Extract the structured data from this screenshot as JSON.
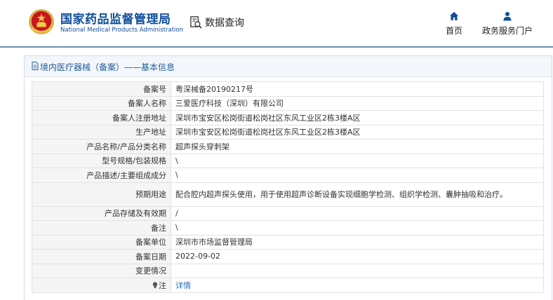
{
  "header": {
    "brand_cn": "国家药品监督管理局",
    "brand_en": "National Medical Products Administration",
    "query_label": "数据查询",
    "nav": {
      "home": "首页",
      "service": "政务服务门户"
    }
  },
  "panel": {
    "title": "境内医疗器械（备案）——基本信息"
  },
  "rows": [
    {
      "label": "备案号",
      "value": "粤深械备20190217号"
    },
    {
      "label": "备案人名称",
      "value": "三爱医疗科技（深圳）有限公司"
    },
    {
      "label": "备案人注册地址",
      "value": "深圳市宝安区松岗街道松岗社区东风工业区2栋3楼A区"
    },
    {
      "label": "生产地址",
      "value": "深圳市宝安区松岗街道松岗社区东风工业区2栋3楼A区"
    },
    {
      "label": "产品名称/产品分类名称",
      "value": "超声探头穿刺架"
    },
    {
      "label": "型号规格/包装规格",
      "value": "\\"
    },
    {
      "label": "产品描述/主要组成成分",
      "value": "\\"
    },
    {
      "label": "预期用途",
      "value": "配合腔内超声探头使用，用于使用超声诊断设备实现细胞学检测、组织学检测、囊肿抽吸和治疗。"
    },
    {
      "label": "产品存储及有效期",
      "value": "/"
    },
    {
      "label": "备注",
      "value": "\\"
    },
    {
      "label": "备案单位",
      "value": "深圳市市场监督管理局"
    },
    {
      "label": "备案日期",
      "value": "2022-09-02"
    },
    {
      "label": "变更情况",
      "value": ""
    },
    {
      "label": "注",
      "value": "详情"
    }
  ],
  "icons": {
    "logo": "national-emblem-icon",
    "query": "search-document-icon",
    "home": "home-icon",
    "service": "user-icon",
    "title": "document-icon",
    "note": "lightbulb-icon"
  },
  "colors": {
    "brand": "#0f4e9c",
    "title": "#1f5c99",
    "link": "#1f6fbf",
    "divider": "#6f8faf"
  }
}
